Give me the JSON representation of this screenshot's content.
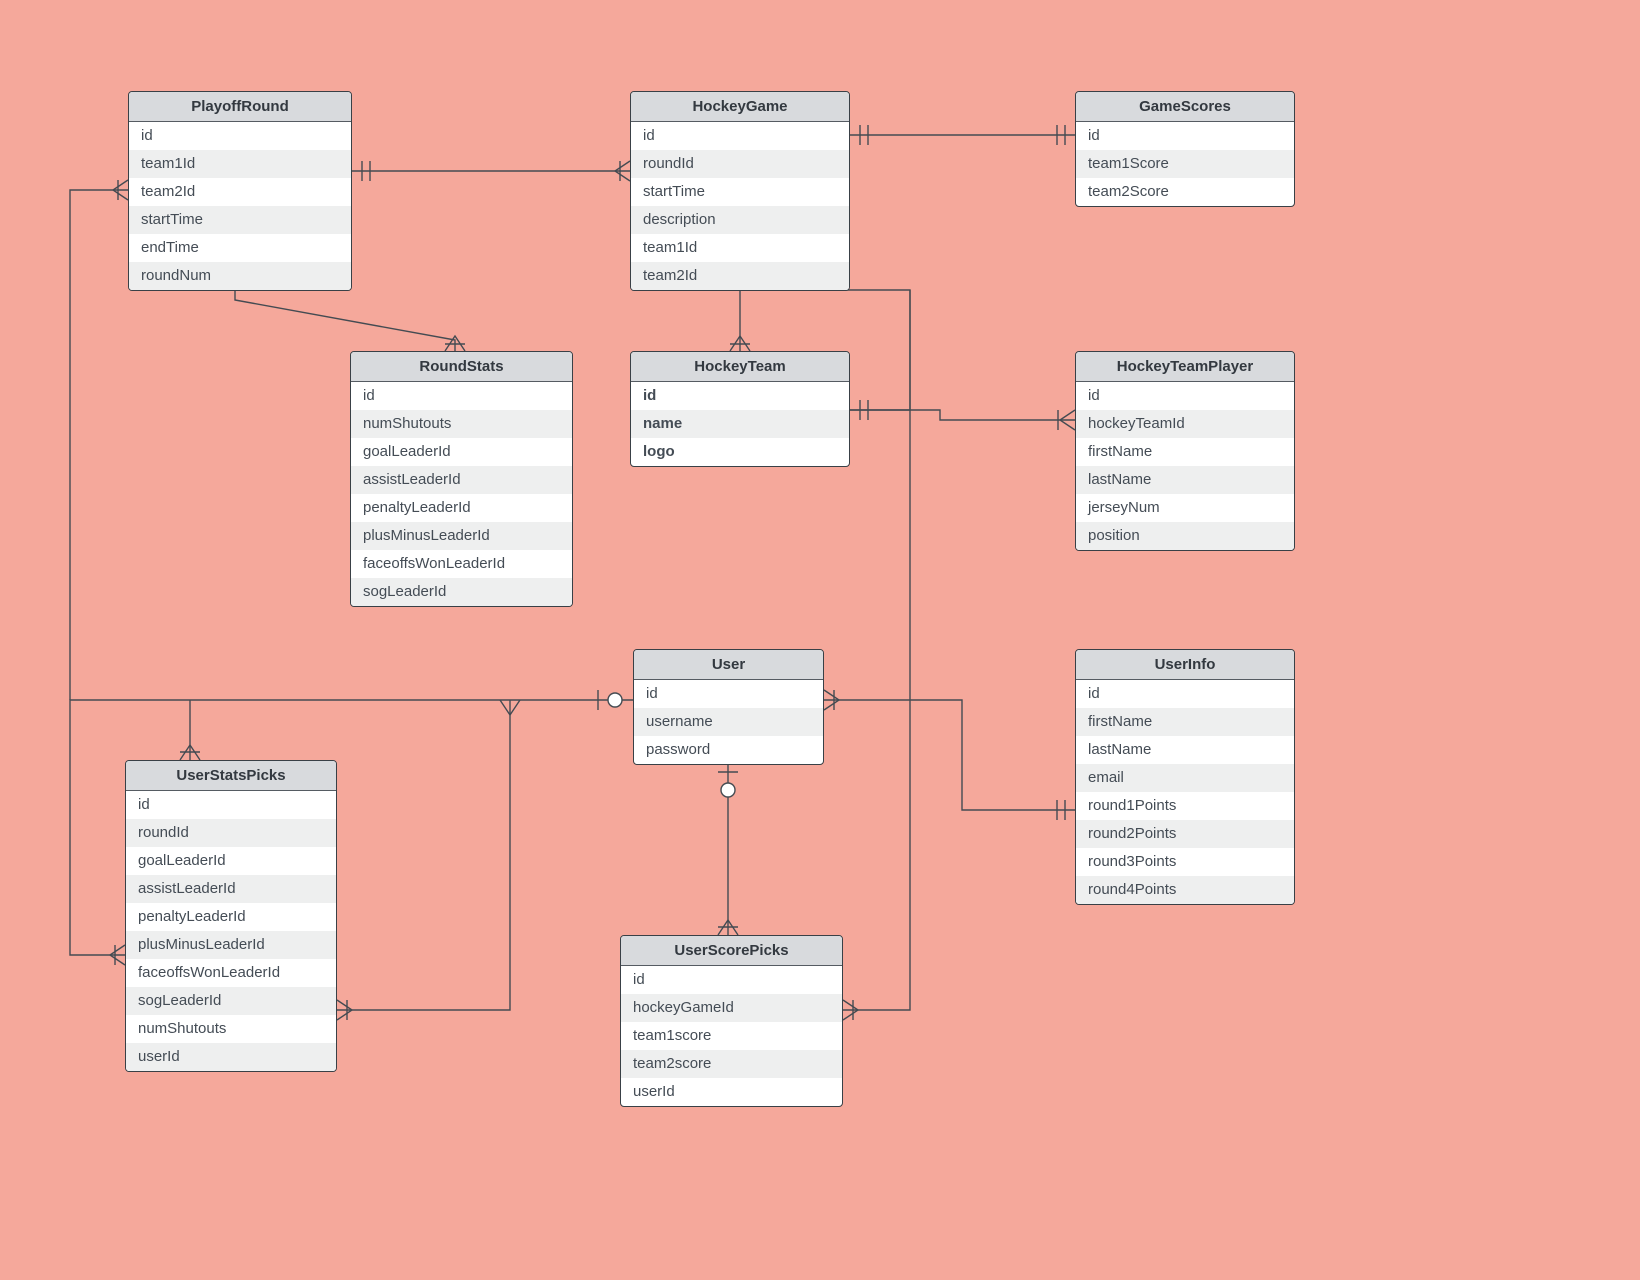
{
  "entities": {
    "playoffRound": {
      "title": "PlayoffRound",
      "rows": [
        "id",
        "team1Id",
        "team2Id",
        "startTime",
        "endTime",
        "roundNum"
      ]
    },
    "hockeyGame": {
      "title": "HockeyGame",
      "rows": [
        "id",
        "roundId",
        "startTime",
        "description",
        "team1Id",
        "team2Id"
      ]
    },
    "gameScores": {
      "title": "GameScores",
      "rows": [
        "id",
        "team1Score",
        "team2Score"
      ]
    },
    "roundStats": {
      "title": "RoundStats",
      "rows": [
        "id",
        "numShutouts",
        "goalLeaderId",
        "assistLeaderId",
        "penaltyLeaderId",
        "plusMinusLeaderId",
        "faceoffsWonLeaderId",
        "sogLeaderId"
      ]
    },
    "hockeyTeam": {
      "title": "HockeyTeam",
      "rows": [
        "id",
        "name",
        "logo"
      ]
    },
    "hockeyTeamPlayer": {
      "title": "HockeyTeamPlayer",
      "rows": [
        "id",
        "hockeyTeamId",
        "firstName",
        "lastName",
        "jerseyNum",
        "position"
      ]
    },
    "user": {
      "title": "User",
      "rows": [
        "id",
        "username",
        "password"
      ]
    },
    "userInfo": {
      "title": "UserInfo",
      "rows": [
        "id",
        "firstName",
        "lastName",
        "email",
        "round1Points",
        "round2Points",
        "round3Points",
        "round4Points"
      ]
    },
    "userStatsPicks": {
      "title": "UserStatsPicks",
      "rows": [
        "id",
        "roundId",
        "goalLeaderId",
        "assistLeaderId",
        "penaltyLeaderId",
        "plusMinusLeaderId",
        "faceoffsWonLeaderId",
        "sogLeaderId",
        "numShutouts",
        "userId"
      ]
    },
    "userScorePicks": {
      "title": "UserScorePicks",
      "rows": [
        "id",
        "hockeyGameId",
        "team1score",
        "team2score",
        "userId"
      ]
    }
  }
}
